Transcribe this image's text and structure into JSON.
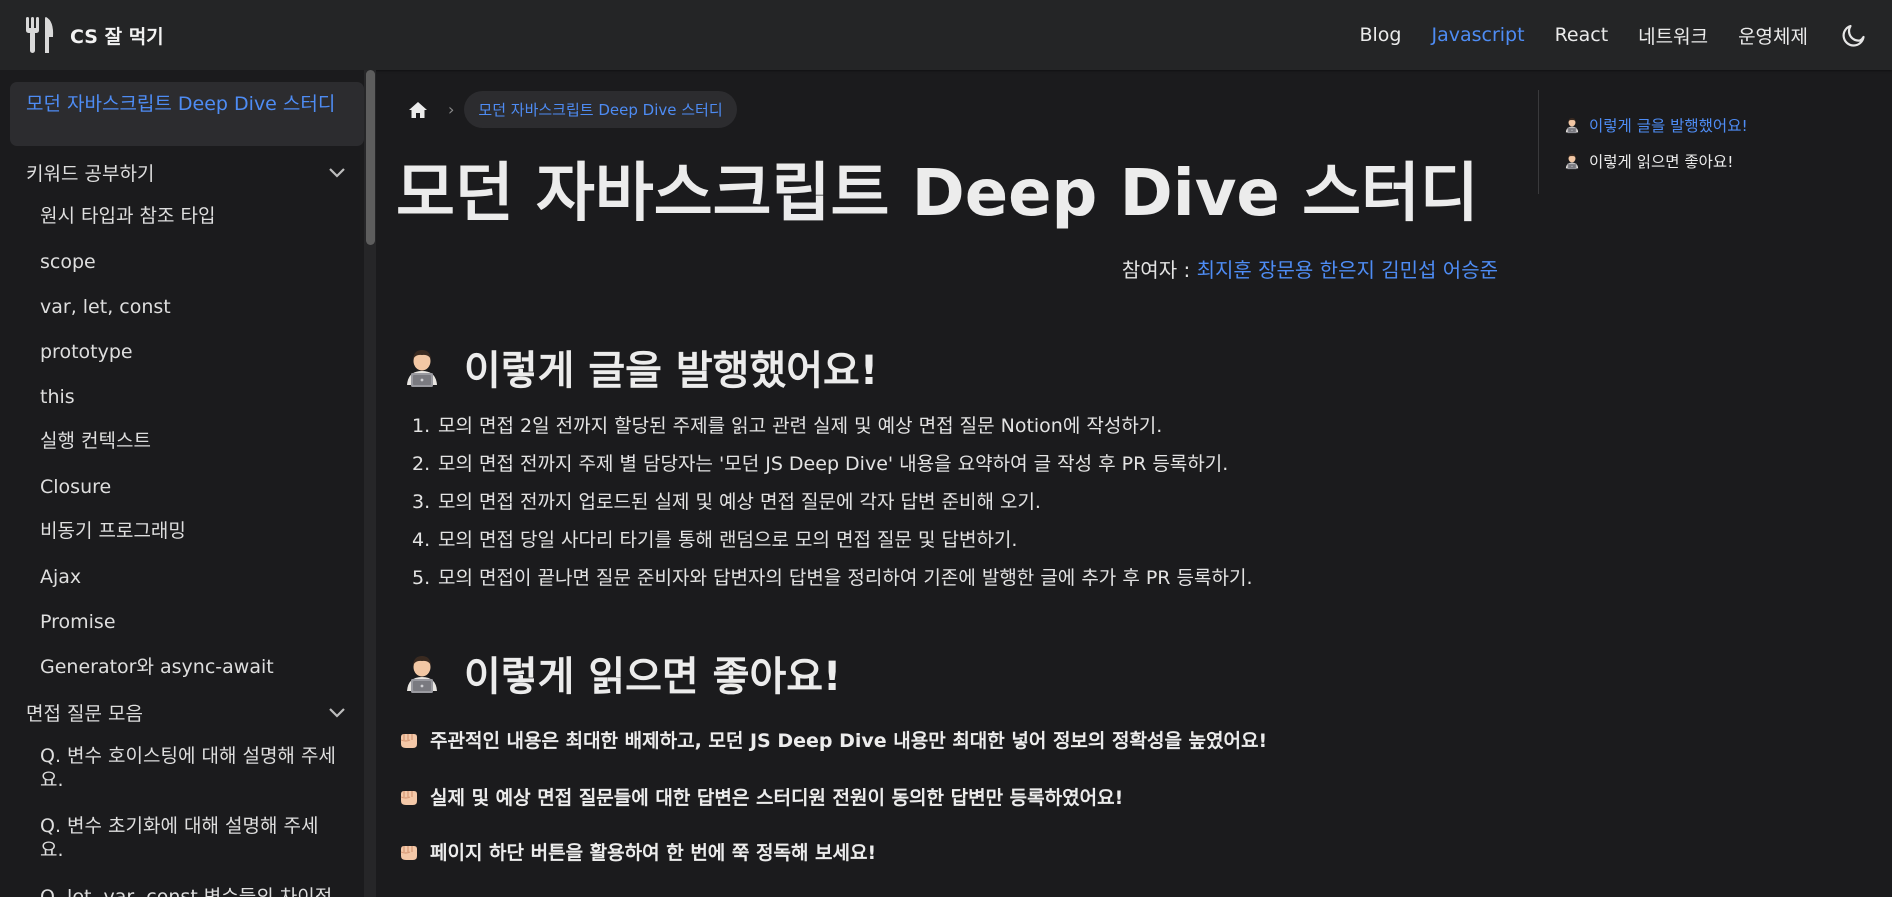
{
  "navbar": {
    "brand": "CS 잘 먹기",
    "links": [
      "Blog",
      "Javascript",
      "React",
      "네트워크",
      "운영체제"
    ],
    "active_index": 1
  },
  "sidebar": {
    "active_item": "모던 자바스크립트 Deep Dive 스터디",
    "category1": "키워드 공부하기",
    "items1": [
      "원시 타입과 참조 타입",
      "scope",
      "var, let, const",
      "prototype",
      "this",
      "실행 컨텍스트",
      "Closure",
      "비동기 프로그래밍",
      "Ajax",
      "Promise",
      "Generator와 async-await"
    ],
    "category2": "면접 질문 모음",
    "items2": [
      "Q. 변수 호이스팅에 대해 설명해 주세요.",
      "Q. 변수 초기화에 대해 설명해 주세요.",
      "Q. let, var, const 변수들의 차이점"
    ]
  },
  "breadcrumb": {
    "current": "모던 자바스크립트 Deep Dive 스터디"
  },
  "page": {
    "title": "모던 자바스크립트 Deep Dive 스터디",
    "participants_label": "참여자 : ",
    "participants_names": "최지훈 장문용 한은지 김민섭 어승준",
    "section1_title": "이렇게 글을 발행했어요!",
    "section1_list": [
      "모의 면접 2일 전까지 할당된 주제를 읽고 관련 실제 및 예상 면접 질문 Notion에 작성하기.",
      "모의 면접 전까지 주제 별 담당자는 '모던 JS Deep Dive' 내용을 요약하여 글 작성 후 PR 등록하기.",
      "모의 면접 전까지 업로드된 실제 및 예상 면접 질문에 각자 답변 준비해 오기.",
      "모의 면접 당일 사다리 타기를 통해 랜덤으로 모의 면접 질문 및 답변하기.",
      "모의 면접이 끝나면 질문 준비자와 답변자의 답변을 정리하여 기존에 발행한 글에 추가 후 PR 등록하기."
    ],
    "section2_title": "이렇게 읽으면 좋아요!",
    "section2_tips": [
      "주관적인 내용은 최대한 배제하고, 모던 JS Deep Dive 내용만 최대한 넣어 정보의 정확성을 높였어요!",
      "실제 및 예상 면접 질문들에 대한 답변은 스터디원 전원이 동의한 답변만 등록하였어요!",
      "페이지 하단 버튼을 활용하여 한 번에 쭉 정독해 보세요!"
    ]
  },
  "toc": {
    "items": [
      "이렇게 글을 발행했어요!",
      "이렇게 읽으면 좋아요!"
    ]
  },
  "colors": {
    "accent": "#4e8cf4",
    "background": "#1b1b1d",
    "navbar": "#242526"
  },
  "icons": {
    "brand": "fork-knife-icon",
    "theme": "moon-icon",
    "home": "home-icon",
    "section": "technologist-emoji-icon",
    "tip": "fist-emoji-icon"
  }
}
